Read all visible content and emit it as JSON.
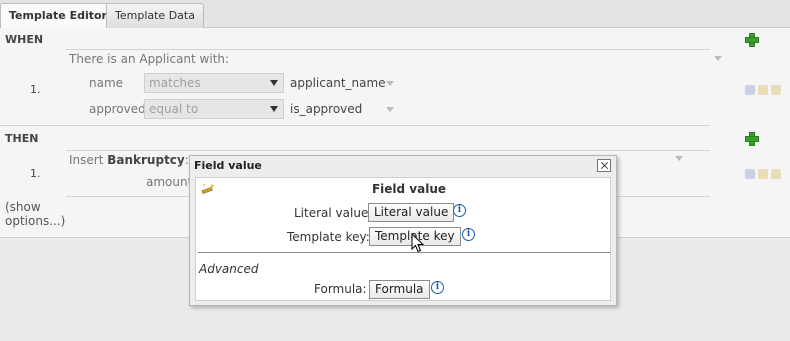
{
  "tabs": [
    {
      "label": "Template Editor",
      "active": true
    },
    {
      "label": "Template Data",
      "active": false
    }
  ],
  "when": {
    "label": "WHEN",
    "pattern_text": "There is an Applicant with:",
    "row_number": "1.",
    "constraints": [
      {
        "field": "name",
        "operator": "matches",
        "value": "applicant_name"
      },
      {
        "field": "approved",
        "operator": "equal to",
        "value": "is_approved"
      }
    ]
  },
  "then": {
    "label": "THEN",
    "row_number": "1.",
    "insert_prefix": "Insert",
    "fact_type": "Bankruptcy",
    "fact_suffix": ":",
    "field": "amount"
  },
  "show_options": "(show options...)",
  "dialog": {
    "title": "Field value",
    "heading": "Field value",
    "literal_label": "Literal value:",
    "literal_button": "Literal value",
    "template_label": "Template key:",
    "template_button": "Template key",
    "advanced_label": "Advanced",
    "formula_label": "Formula:",
    "formula_button": "Formula",
    "info_glyph": "i"
  },
  "colors": {
    "add_icon": "#39a02b",
    "info_icon": "#1b5fa8"
  }
}
